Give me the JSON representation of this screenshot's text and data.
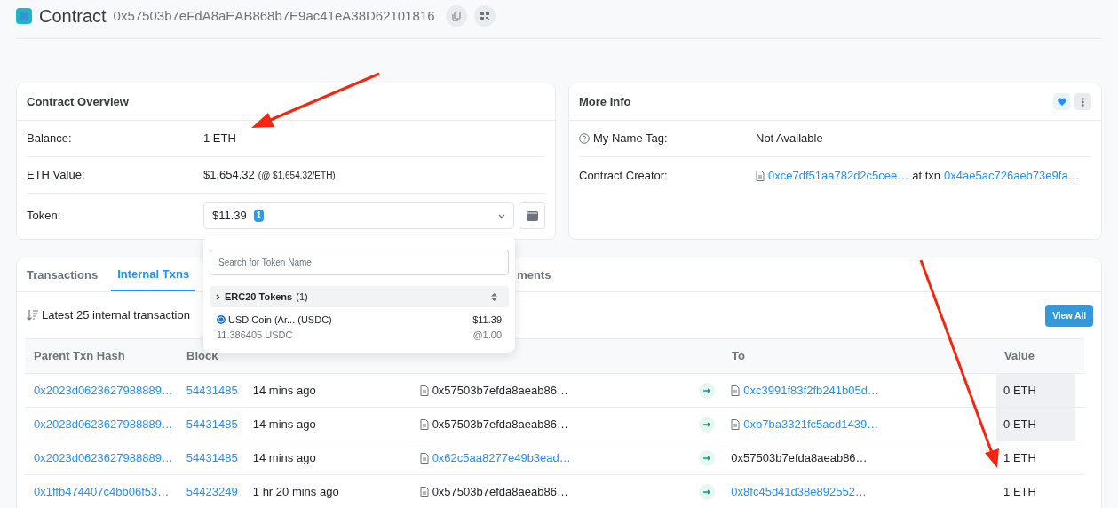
{
  "header": {
    "title": "Contract",
    "address": "0x57503b7eFdA8aEAB868b7E9ac41eA38D62101816"
  },
  "overview": {
    "title": "Contract Overview",
    "balance_label": "Balance:",
    "balance": "1 ETH",
    "value_label": "ETH Value:",
    "value": "$1,654.32",
    "value_rate": "(@ $1,654.32/ETH)",
    "token_label": "Token:",
    "token_value": "$11.39",
    "token_count": "1"
  },
  "more_info": {
    "title": "More Info",
    "favorited": true,
    "name_tag_label": "My Name Tag:",
    "name_tag": "Not Available",
    "creator_label": "Contract Creator:",
    "creator": "0xce7df51aa782d2c5cee…",
    "at_txn": "at txn",
    "creator_txn": "0x4ae5ac726aeb73e9fa…"
  },
  "token_dropdown": {
    "placeholder": "Search for Token Name",
    "group": "ERC20 Tokens",
    "group_count": "(1)",
    "expanded": false,
    "tokens": [
      {
        "name": "USD Coin (Ar... (USDC)",
        "value": "$11.39",
        "amount": "11.386405 USDC",
        "rate": "@1.00"
      }
    ]
  },
  "tabs": [
    {
      "label": "Transactions",
      "selected": false
    },
    {
      "label": "Internal Txns",
      "selected": true
    },
    {
      "label": "ments",
      "selected": false
    }
  ],
  "summary": "Latest 25 internal transaction",
  "view_all": "View All",
  "table": {
    "columns": [
      {
        "kind": "hash",
        "label": "Parent Txn Hash"
      },
      {
        "kind": "block",
        "label": "Block"
      },
      {
        "kind": "to",
        "label": "To"
      },
      {
        "kind": "value",
        "label": "Value"
      }
    ],
    "rows": [
      {
        "hash": "0x2023d0623627988889…",
        "block": "54431485",
        "age": "14 mins ago",
        "from": {
          "text": "0x57503b7efda8aeab86…",
          "link": false,
          "contract": true
        },
        "to": {
          "text": "0xc3991f83f2fb241b05d…",
          "link": true,
          "contract": true
        },
        "value": "0 ETH",
        "highlighted": true
      },
      {
        "hash": "0x2023d0623627988889…",
        "block": "54431485",
        "age": "14 mins ago",
        "from": {
          "text": "0x57503b7efda8aeab86…",
          "link": false,
          "contract": true
        },
        "to": {
          "text": "0xb7ba3321fc5acd1439…",
          "link": true,
          "contract": true
        },
        "value": "0 ETH",
        "highlighted": true
      },
      {
        "hash": "0x2023d0623627988889…",
        "block": "54431485",
        "age": "14 mins ago",
        "from": {
          "text": "0x62c5aa8277e49b3ead…",
          "link": true,
          "contract": true
        },
        "to": {
          "text": "0x57503b7efda8aeab86…",
          "link": false,
          "contract": false
        },
        "value": "1 ETH",
        "highlighted": false
      },
      {
        "hash": "0x1ffb474407c4bb06f53…",
        "block": "54423249",
        "age": "1 hr 20 mins ago",
        "from": {
          "text": "0x57503b7efda8aeab86…",
          "link": false,
          "contract": true
        },
        "to": {
          "text": "0x8fc45d41d38e892552…",
          "link": true,
          "contract": false
        },
        "value": "1 ETH",
        "highlighted": false
      }
    ]
  }
}
